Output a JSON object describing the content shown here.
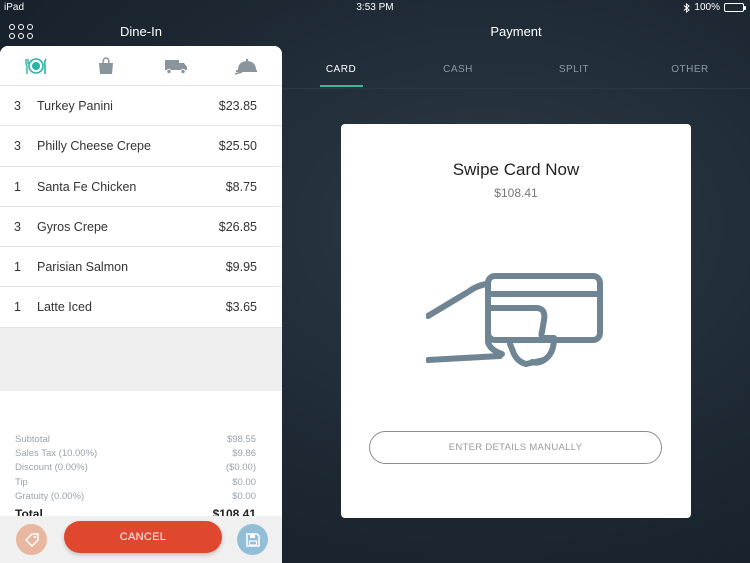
{
  "status_bar": {
    "device": "iPad",
    "time": "3:53 PM",
    "battery": "100%"
  },
  "order": {
    "title": "Dine-In",
    "items": [
      {
        "qty": "3",
        "name": "Turkey Panini",
        "price": "$23.85"
      },
      {
        "qty": "3",
        "name": "Philly Cheese Crepe",
        "price": "$25.50"
      },
      {
        "qty": "1",
        "name": "Santa Fe Chicken",
        "price": "$8.75"
      },
      {
        "qty": "3",
        "name": "Gyros Crepe",
        "price": "$26.85"
      },
      {
        "qty": "1",
        "name": "Parisian Salmon",
        "price": "$9.95"
      },
      {
        "qty": "1",
        "name": "Latte Iced",
        "price": "$3.65"
      }
    ],
    "totals": {
      "subtotal_label": "Subtotal",
      "subtotal": "$98.55",
      "tax_label": "Sales Tax (10.00%)",
      "tax": "$9.86",
      "discount_label": "Discount (0.00%)",
      "discount": "($0.00)",
      "tip_label": "Tip",
      "tip": "$0.00",
      "gratuity_label": "Gratuity (0.00%)",
      "gratuity": "$0.00",
      "total_label": "Total",
      "total": "$108.41"
    },
    "cancel_label": "CANCEL"
  },
  "payment": {
    "title": "Payment",
    "tabs": [
      "CARD",
      "CASH",
      "SPLIT",
      "OTHER"
    ],
    "active_tab": "CARD",
    "heading": "Swipe Card Now",
    "amount": "$108.41",
    "manual_label": "ENTER DETAILS MANUALLY"
  },
  "colors": {
    "accent": "#3db5a7",
    "cancel": "#e0472f",
    "icon_active": "#2bb3a6",
    "icon_inactive": "#8a949d",
    "illustration": "#6f8593"
  }
}
